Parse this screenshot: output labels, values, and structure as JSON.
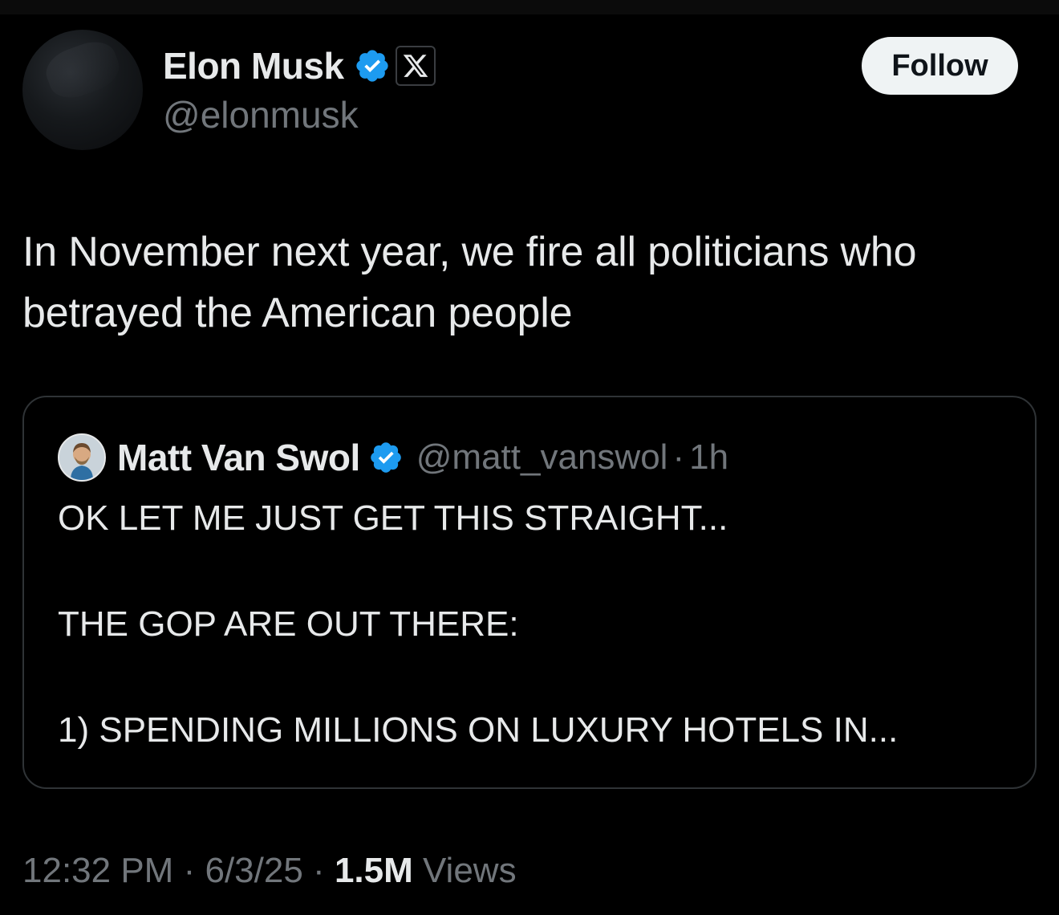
{
  "author": {
    "display_name": "Elon Musk",
    "handle": "@elonmusk",
    "verified": true,
    "affiliation_icon": "x-logo-icon"
  },
  "follow_label": "Follow",
  "tweet": {
    "text": "In November next year, we fire all politicians who betrayed the American people"
  },
  "quoted_tweet": {
    "display_name": "Matt Van Swol",
    "handle": "@matt_vanswol",
    "separator": "·",
    "time": "1h",
    "text": "OK LET ME JUST GET THIS STRAIGHT...\n\nTHE GOP ARE OUT THERE:\n\n1) SPENDING MILLIONS ON LUXURY HOTELS IN..."
  },
  "meta": {
    "time": "12:32 PM",
    "sep1": "·",
    "date": "6/3/25",
    "sep2": "·",
    "views_count": "1.5M",
    "views_label": "Views"
  },
  "colors": {
    "background": "#000000",
    "text": "#e7e9ea",
    "secondary": "#71767b",
    "verified_blue": "#1d9bf0",
    "border": "#2f3336"
  }
}
